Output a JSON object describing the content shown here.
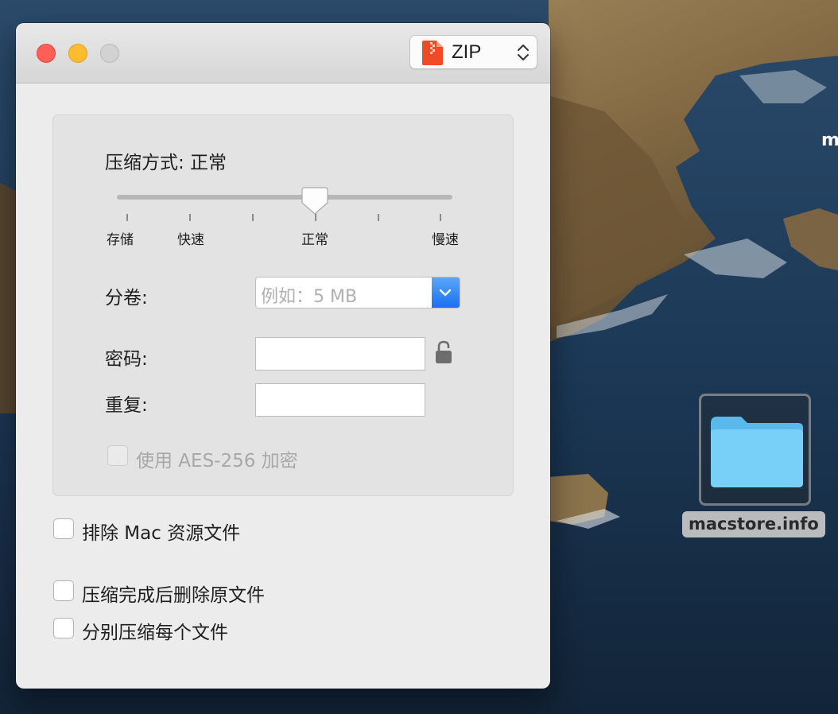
{
  "window": {
    "format_select": {
      "value": "ZIP",
      "icon": "zip-archive-icon"
    },
    "compression": {
      "title": "压缩方式: 正常",
      "levels": [
        "存储",
        "快速",
        "正常",
        "慢速"
      ],
      "selected_level": "正常"
    },
    "split": {
      "label": "分卷:",
      "placeholder": "例如：5 MB"
    },
    "password": {
      "label": "密码:",
      "value": ""
    },
    "repeat": {
      "label": "重复:",
      "value": ""
    },
    "aes": {
      "label": "使用 AES-256 加密",
      "checked": false,
      "enabled": false
    },
    "options": [
      {
        "label": "排除 Mac 资源文件",
        "checked": false
      },
      {
        "label": "压缩完成后删除原文件",
        "checked": false
      },
      {
        "label": "分别压缩每个文件",
        "checked": false
      }
    ]
  },
  "desktop": {
    "folder_label": "macstore.info",
    "edge_text": "m"
  },
  "colors": {
    "close": "#ff5f57",
    "minimize": "#febc2e",
    "accent_blue": "#1a70f1",
    "folder_blue": "#6fcaf6"
  }
}
